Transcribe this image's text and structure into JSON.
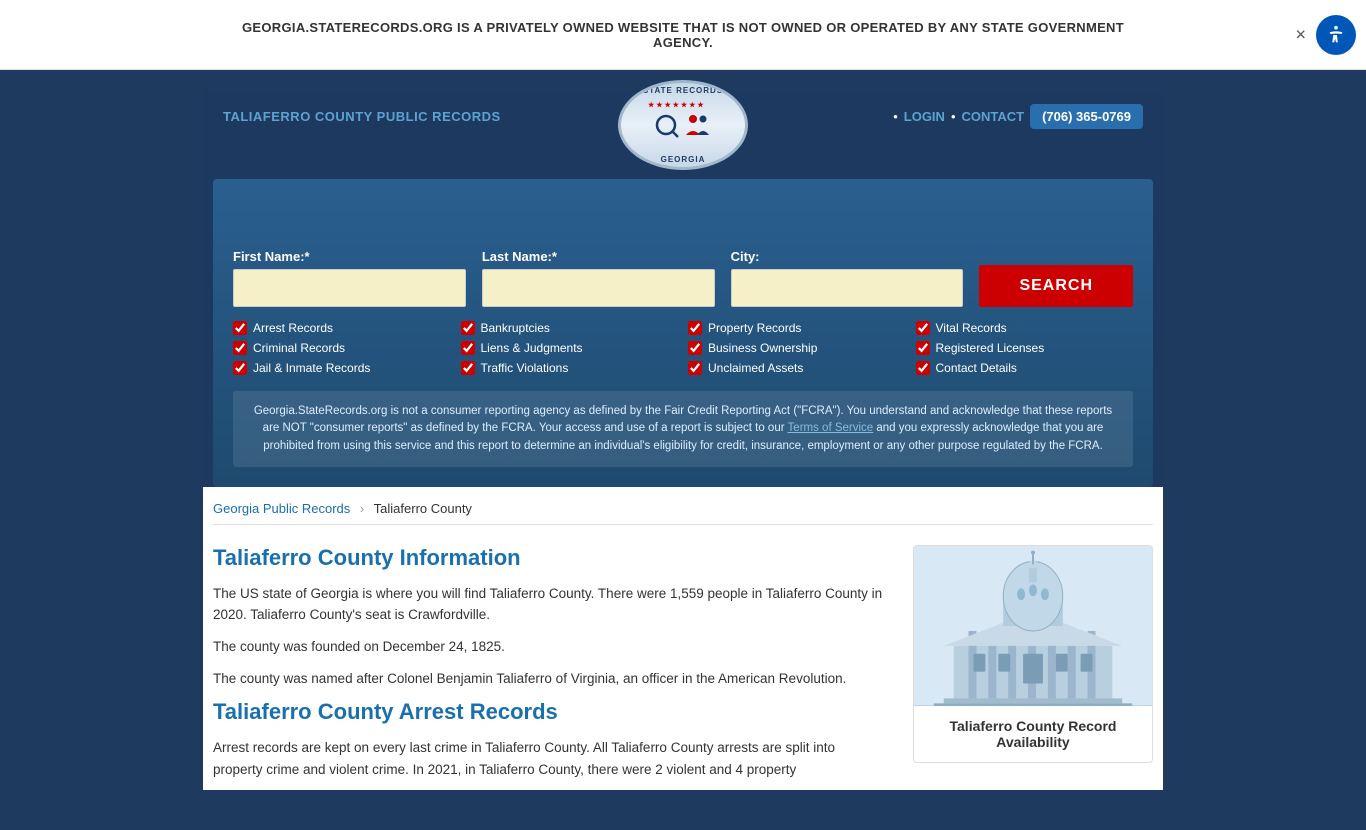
{
  "banner": {
    "text": "GEORGIA.STATERECORDS.ORG IS A PRIVATELY OWNED WEBSITE THAT IS NOT OWNED OR OPERATED BY ANY STATE GOVERNMENT AGENCY.",
    "close_label": "×"
  },
  "header": {
    "site_title": "TALIAFERRO COUNTY PUBLIC RECORDS",
    "nav": {
      "login": "LOGIN",
      "contact": "CONTACT",
      "phone": "(706) 365-0769"
    },
    "logo": {
      "top": "STATE RECORDS",
      "bottom": "GEORGIA"
    }
  },
  "search_form": {
    "first_name_label": "First Name:*",
    "last_name_label": "Last Name:*",
    "city_label": "City:",
    "first_name_placeholder": "",
    "last_name_placeholder": "",
    "city_placeholder": "",
    "search_button": "SEARCH"
  },
  "checkboxes": [
    {
      "label": "Arrest Records",
      "checked": true
    },
    {
      "label": "Bankruptcies",
      "checked": true
    },
    {
      "label": "Property Records",
      "checked": true
    },
    {
      "label": "Vital Records",
      "checked": true
    },
    {
      "label": "Criminal Records",
      "checked": true
    },
    {
      "label": "Liens & Judgments",
      "checked": true
    },
    {
      "label": "Business Ownership",
      "checked": true
    },
    {
      "label": "Registered Licenses",
      "checked": true
    },
    {
      "label": "Jail & Inmate Records",
      "checked": true
    },
    {
      "label": "Traffic Violations",
      "checked": true
    },
    {
      "label": "Unclaimed Assets",
      "checked": true
    },
    {
      "label": "Contact Details",
      "checked": true
    }
  ],
  "disclaimer": {
    "text1": "Georgia.StateRecords.org is not a consumer reporting agency as defined by the Fair Credit Reporting Act (\"FCRA\"). You understand and acknowledge that these reports are NOT \"consumer reports\" as defined by the FCRA. Your access and use of a report is subject to our ",
    "tos_link": "Terms of Service",
    "text2": " and you expressly acknowledge that you are prohibited from using this service and this report to determine an individual's eligibility for credit, insurance, employment or any other purpose regulated by the FCRA."
  },
  "breadcrumb": {
    "parent_link": "Georgia Public Records",
    "current": "Taliaferro County"
  },
  "main_content": {
    "section1_title": "Taliaferro County Information",
    "section1_p1": "The US state of Georgia is where you will find Taliaferro County. There were 1,559 people in Taliaferro County in 2020. Taliaferro County's seat is Crawfordville.",
    "section1_p2": "The county was founded on December 24, 1825.",
    "section1_p3": "The county was named after Colonel Benjamin Taliaferro of Virginia, an officer in the American Revolution.",
    "section2_title": "Taliaferro County Arrest Records",
    "section2_p1": "Arrest records are kept on every last crime in Taliaferro County. All Taliaferro County arrests are split into property crime and violent crime. In 2021, in Taliaferro County, there were 2 violent and 4 property"
  },
  "sidebar": {
    "card_title": "Taliaferro County Record Availability"
  }
}
